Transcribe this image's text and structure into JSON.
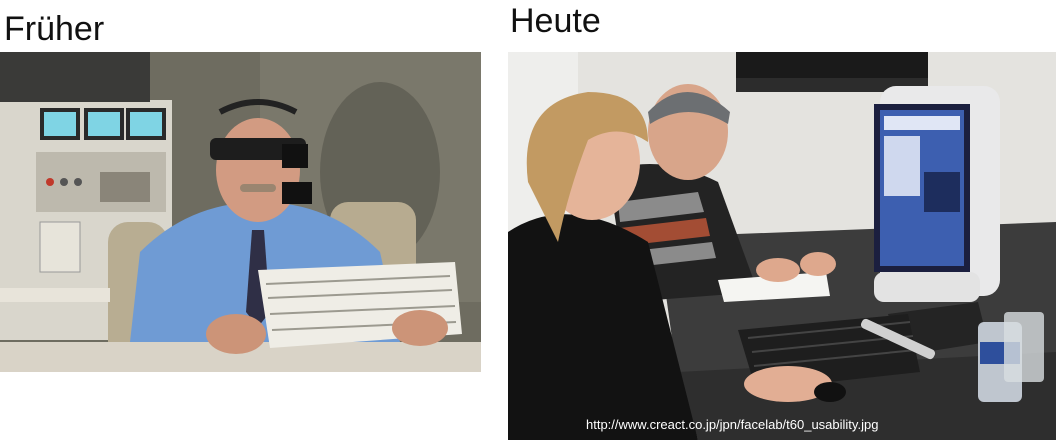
{
  "left_panel": {
    "heading": "Früher"
  },
  "right_panel": {
    "heading": "Heute",
    "source_caption": "http://www.creact.co.jp/jpn/facelab/t60_usability.jpg"
  },
  "colors": {
    "background": "#ffffff",
    "heading_text": "#111111",
    "caption_text": "#ffffff"
  }
}
